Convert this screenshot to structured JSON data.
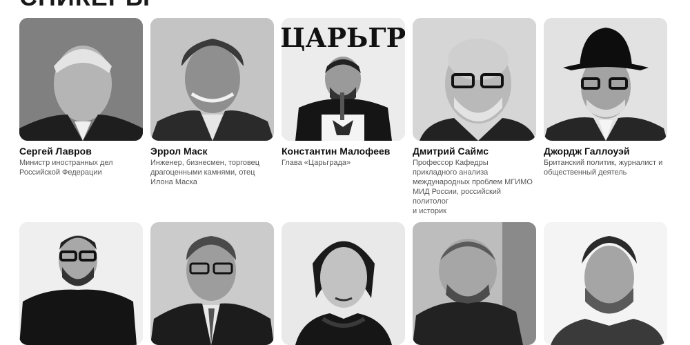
{
  "section_title": "СПИКЕРЫ",
  "speakers": [
    {
      "name": "Сергей Лавров",
      "role": "Министр иностранных дел\nРоссийской Федерации"
    },
    {
      "name": "Эррол Маск",
      "role": "Инженер, бизнесмен, торговец\nдрагоценными камнями, отец\nИлона Маска"
    },
    {
      "name": "Константин Малофеев",
      "role": "Глава «Царьграда»"
    },
    {
      "name": "Дмитрий Саймс",
      "role": "Профессор Кафедры\nприкладного анализа\nмеждународных проблем МГИМО\nМИД России, российский\nполитолог\nи историк"
    },
    {
      "name": "Джордж Галлоуэй",
      "role": "Британский политик, журналист и\nобщественный деятель"
    }
  ],
  "backdrop_text": "ЦАРЬГР"
}
